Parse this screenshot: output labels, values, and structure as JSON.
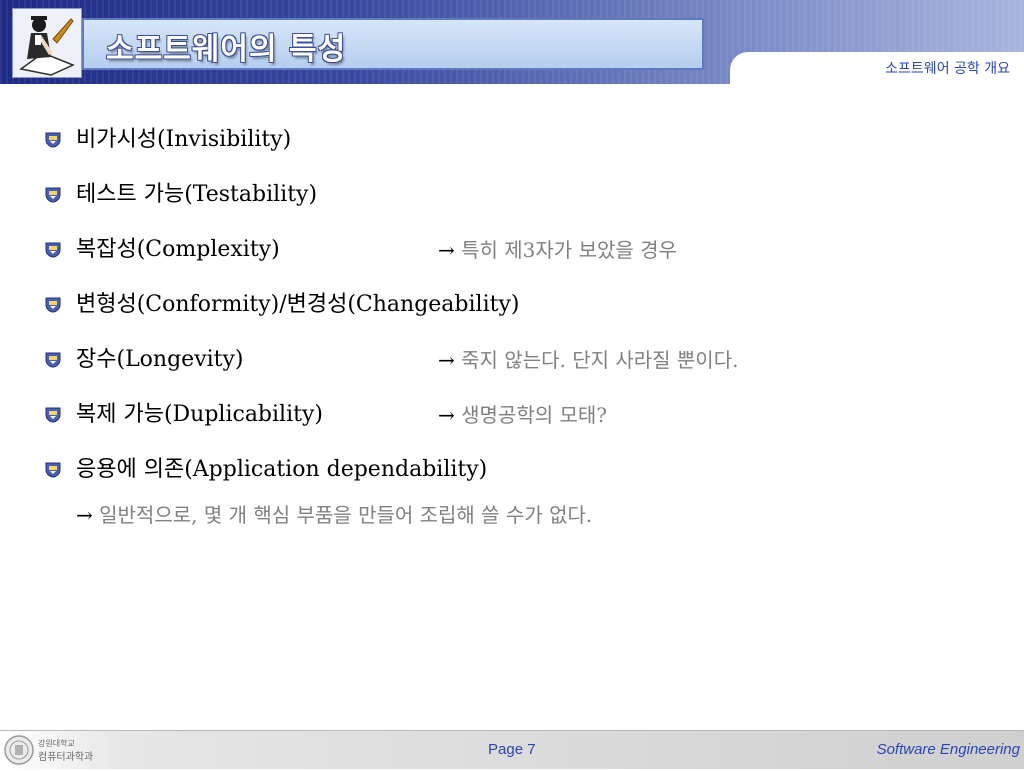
{
  "header": {
    "title": "소프트웨어의 특성",
    "course": "소프트웨어 공학 개요"
  },
  "items": [
    {
      "label": "비가시성(Invisibility)"
    },
    {
      "label": "테스트 가능(Testability)"
    },
    {
      "label": "복잡성(Complexity)",
      "note": "특히 제3자가 보았을 경우"
    },
    {
      "label": "변형성(Conformity)/변경성(Changeability)"
    },
    {
      "label": "장수(Longevity)",
      "note": "죽지 않는다. 단지 사라질 뿐이다."
    },
    {
      "label": "복제 가능(Duplicability)",
      "note": "생명공학의 모태?"
    },
    {
      "label": "응용에 의존(Application dependability)"
    }
  ],
  "sub_note": "일반적으로, 몇 개 핵심 부품을 만들어 조립해 쓸 수가 없다.",
  "arrow_symbol": "→",
  "footer": {
    "org_line1": "강원대학교",
    "org_line2": "컴퓨터과학과",
    "page": "Page 7",
    "course": "Software Engineering"
  },
  "colors": {
    "header_dark": "#1f2a86",
    "accent_blue": "#2b46b5",
    "note_gray": "#808080"
  },
  "icons": {
    "logo": "scholar-with-quill-icon",
    "bullet": "shield-bullet-icon",
    "footer_logo": "university-seal-icon"
  }
}
